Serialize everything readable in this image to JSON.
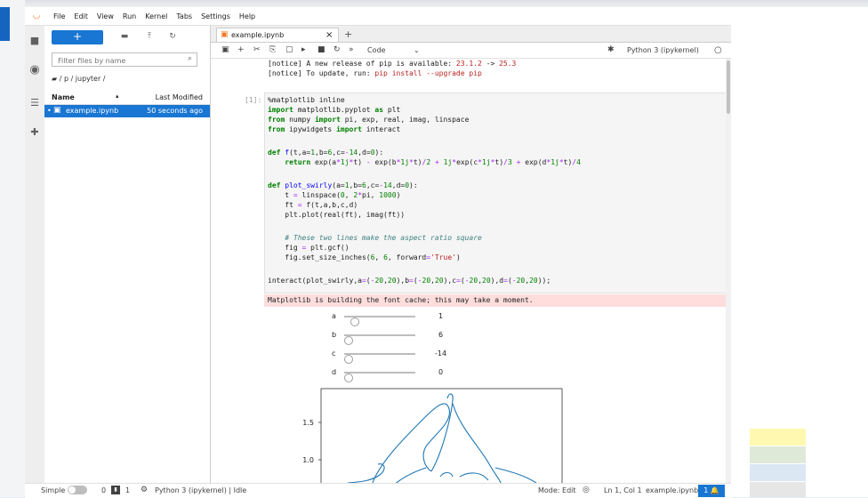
{
  "menubar": {
    "items": [
      "File",
      "Edit",
      "View",
      "Run",
      "Kernel",
      "Tabs",
      "Settings",
      "Help"
    ]
  },
  "filebrowser": {
    "new_label": "+",
    "filter_placeholder": "Filter files by name",
    "breadcrumb": "/ p / jupyter /",
    "col_name": "Name",
    "col_modified": "Last Modified",
    "files": [
      {
        "name": "example.ipynb",
        "modified": "50 seconds ago"
      }
    ]
  },
  "tab": {
    "title": "example.ipynb",
    "close": "×",
    "add": "+"
  },
  "toolbar": {
    "cell_type": "Code",
    "kernel": "Python 3 (ipykernel)"
  },
  "notebook": {
    "notice_lines": [
      {
        "prefix": "[notice] A new release of pip is available: ",
        "old": "23.1.2",
        "arrow": " -> ",
        "new": "25.3"
      },
      {
        "prefix": "[notice] To update, run: ",
        "cmd": "pip install --upgrade pip"
      }
    ],
    "prompt": "[1]:",
    "stderr": "Matplotlib is building the font cache; this may take a moment.",
    "sliders": [
      {
        "label": "a",
        "value": "1",
        "fraction": 0.525
      },
      {
        "label": "b",
        "value": "6",
        "fraction": 0.65
      },
      {
        "label": "c",
        "value": "-14",
        "fraction": 0.15
      },
      {
        "label": "d",
        "value": "0",
        "fraction": 0.5
      }
    ],
    "plot": {
      "yticks": [
        "1.5",
        "1.0"
      ]
    }
  },
  "statusbar": {
    "mode": "Simple",
    "terminals": "0",
    "kernels": "1",
    "kernel_status": "Python 3 (ipykernel) | Idle",
    "edit_mode": "Mode: Edit",
    "position": "Ln 1, Col 1",
    "file": "example.ipynb",
    "notifications": "1"
  },
  "colors": {
    "accent": "#1976d2",
    "error_bg": "#ffdddd",
    "plot_line": "#1f77b4"
  },
  "icons": [
    "jupyter-logo-icon",
    "folder-icon",
    "running-icon",
    "toc-icon",
    "extension-icon",
    "upload-icon",
    "refresh-icon",
    "new-folder-icon",
    "search-icon",
    "notebook-icon",
    "save-icon",
    "cut-icon",
    "copy-icon",
    "paste-icon",
    "run-icon",
    "stop-icon",
    "restart-icon",
    "fast-forward-icon",
    "bug-icon",
    "gear-icon",
    "bell-icon"
  ]
}
